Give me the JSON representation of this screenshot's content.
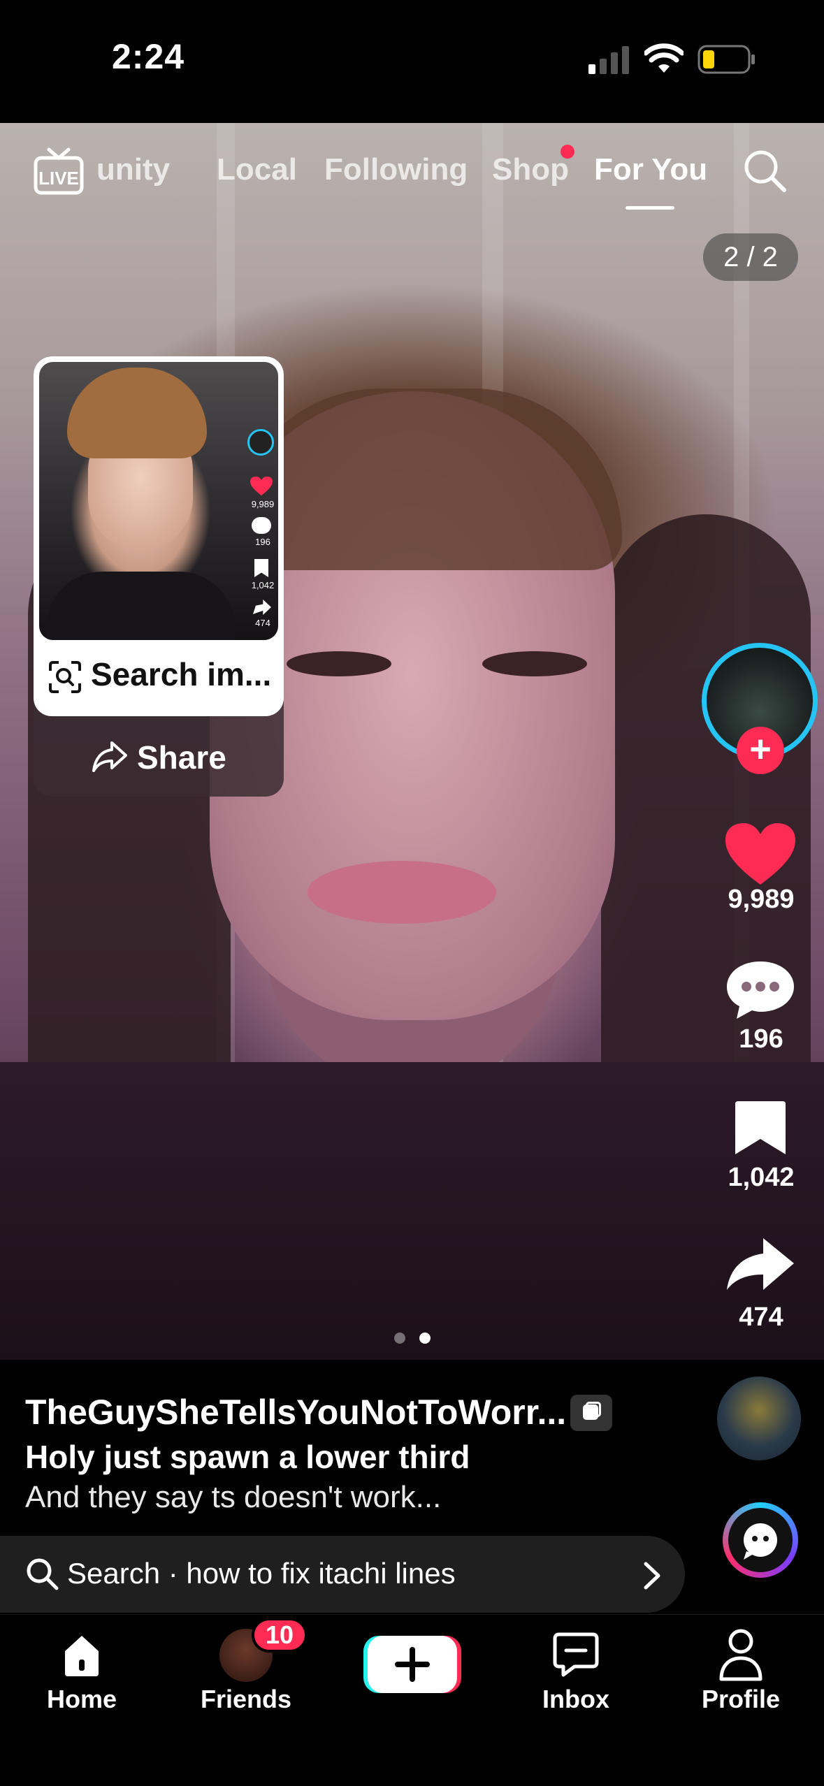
{
  "status_bar": {
    "time": "2:24"
  },
  "top_nav": {
    "tabs": [
      {
        "label": "unity"
      },
      {
        "label": "Local"
      },
      {
        "label": "Following"
      },
      {
        "label": "Shop"
      },
      {
        "label": "For You"
      }
    ],
    "live_label": "LIVE"
  },
  "page_counter": "2 / 2",
  "popup": {
    "search_label": "Search im...",
    "share_label": "Share",
    "thumb_stats": [
      "9,989",
      "196",
      "1,042",
      "474"
    ]
  },
  "right_rail": {
    "likes": "9,989",
    "comments": "196",
    "saves": "1,042",
    "shares": "474"
  },
  "caption": {
    "username": "TheGuySheTellsYouNotToWorr...",
    "title": "Holy just spawn a lower third",
    "description": "And they say ts doesn't work..."
  },
  "search_bar": {
    "text": "Search · how to fix itachi lines"
  },
  "bottom_nav": {
    "home": "Home",
    "friends": "Friends",
    "friends_badge": "10",
    "inbox": "Inbox",
    "profile": "Profile"
  },
  "colors": {
    "accent": "#fe2c55",
    "ring": "#25c4f5"
  }
}
